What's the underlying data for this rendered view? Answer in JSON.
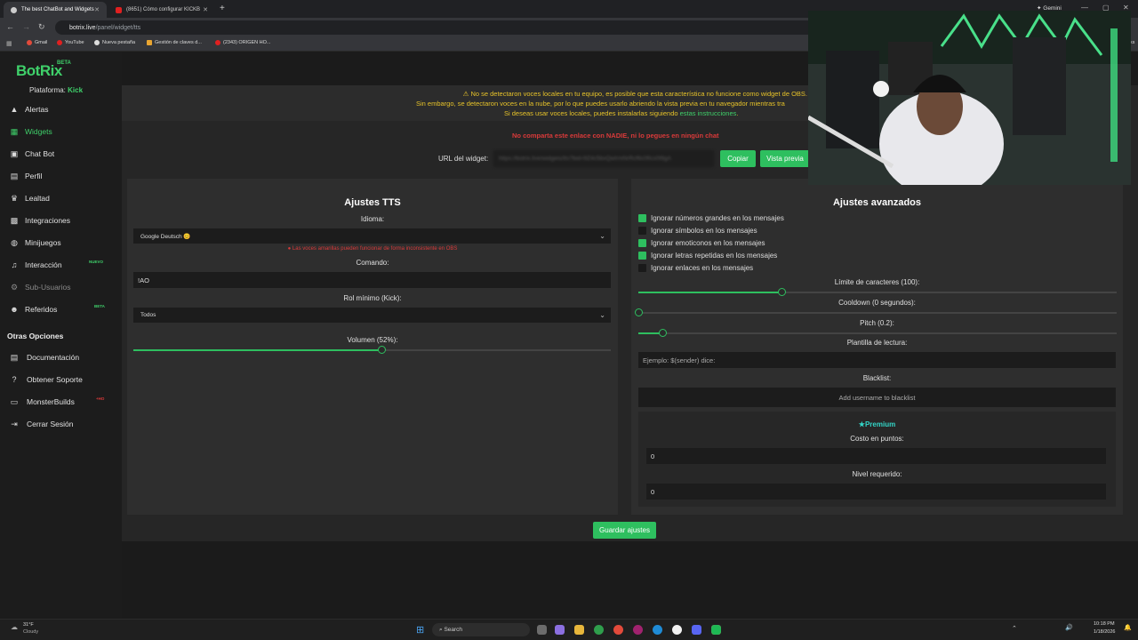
{
  "browser": {
    "tabs": [
      {
        "title": "The best ChatBot and Widgets"
      },
      {
        "title": "(8651) Cómo configurar KICKB"
      }
    ],
    "new_tab": "+",
    "gemini": "Gemini",
    "url_host": "botrix.live",
    "url_path": "/panel/widget/tts",
    "bookmarks": [
      "Gmail",
      "YouTube",
      "Nueva pestaña",
      "Gestión de claves d...",
      "(2343) ORIGEN HO..."
    ],
    "bookmarks_right": "arks"
  },
  "sidebar": {
    "logo": "BotRix",
    "logo_badge": "BETA",
    "platform_label": "Plataforma:",
    "platform_value": "Kick",
    "items": [
      {
        "label": "Alertas",
        "icon": "warning-icon"
      },
      {
        "label": "Widgets",
        "icon": "grid-icon",
        "active": true
      },
      {
        "label": "Chat Bot",
        "icon": "robot-icon"
      },
      {
        "label": "Perfil",
        "icon": "id-card-icon"
      },
      {
        "label": "Lealtad",
        "icon": "trophy-icon"
      },
      {
        "label": "Integraciones",
        "icon": "plug-icon"
      },
      {
        "label": "Minijuegos",
        "icon": "gamepad-icon"
      },
      {
        "label": "Interacción",
        "icon": "music-icon",
        "badge": "NUEVO"
      },
      {
        "label": "Sub-Usuarios",
        "icon": "users-icon",
        "dim": true
      },
      {
        "label": "Referidos",
        "icon": "user-group-icon",
        "badge": "BETA"
      }
    ],
    "section": "Otras Opciones",
    "other_items": [
      {
        "label": "Documentación",
        "icon": "docs-icon"
      },
      {
        "label": "Obtener Soporte",
        "icon": "question-icon"
      },
      {
        "label": "MonsterBuilds",
        "icon": "monitor-icon",
        "badge": "+HO"
      },
      {
        "label": "Cerrar Sesión",
        "icon": "logout-icon"
      }
    ]
  },
  "notice": {
    "line1": "No se detectaron voces locales en tu equipo, es posible que esta característica no funcione como widget de OBS.",
    "line2": "Sin embargo, se detectaron voces en la nube, por lo que puedes usarlo abriendo la vista previa en tu navegador mientras tra",
    "line3_prefix": "Si deseas usar voces locales, puedes instalarlas siguiendo",
    "line3_link": "estas instrucciones",
    "line3_suffix": ".",
    "warning": "No comparta este enlace con NADIE, ni lo pegues en ningún chat"
  },
  "widget_url": {
    "label": "URL del widget:",
    "value": "https://botrix.live/widgets/tts?bid=9Z4c5bxQwIrmNrRcf6c0fIcs0t9gA",
    "copy": "Copiar",
    "preview": "Vista previa"
  },
  "tts": {
    "title": "Ajustes TTS",
    "language_label": "Idioma:",
    "language_value": "Google Deutsch 😊",
    "language_warning": "Las voces amarillas pueden funcionar de forma inconsistente en OBS",
    "command_label": "Comando:",
    "command_value": "!AO",
    "role_label": "Rol mínimo (Kick):",
    "role_value": "Todos",
    "volume_label": "Volumen (52%):",
    "volume_value": 0.52
  },
  "advanced": {
    "title": "Ajustes avanzados",
    "checks": [
      {
        "label": "Ignorar números grandes en los mensajes",
        "checked": true
      },
      {
        "label": "Ignorar símbolos en los mensajes",
        "checked": false
      },
      {
        "label": "Ignorar emoticonos en los mensajes",
        "checked": true
      },
      {
        "label": "Ignorar letras repetidas en los mensajes",
        "checked": true
      },
      {
        "label": "Ignorar enlaces en los mensajes",
        "checked": false
      }
    ],
    "char_limit_label": "Límite de caracteres (100):",
    "char_limit_value": 0.3,
    "cooldown_label": "Cooldown (0 segundos):",
    "cooldown_value": 0,
    "pitch_label": "Pitch (0.2):",
    "pitch_value": 0.05,
    "template_label": "Plantilla de lectura:",
    "template_placeholder": "Ejemplo: $(sender) dice:",
    "blacklist_label": "Blacklist:",
    "blacklist_placeholder": "Add username to blacklist",
    "premium_label": "Premium",
    "cost_label": "Costo en puntos:",
    "cost_value": "0",
    "level_label": "Nivel requerido:",
    "level_value": "0"
  },
  "save_button": "Guardar ajustes",
  "taskbar": {
    "weather_temp": "31°F",
    "weather_desc": "Cloudy",
    "search": "Search",
    "time": "10:18 PM",
    "date": "1/18/2026"
  },
  "colors": {
    "accent": "#2ebf5f",
    "warning": "#e6c229",
    "danger": "#d93a3a"
  }
}
